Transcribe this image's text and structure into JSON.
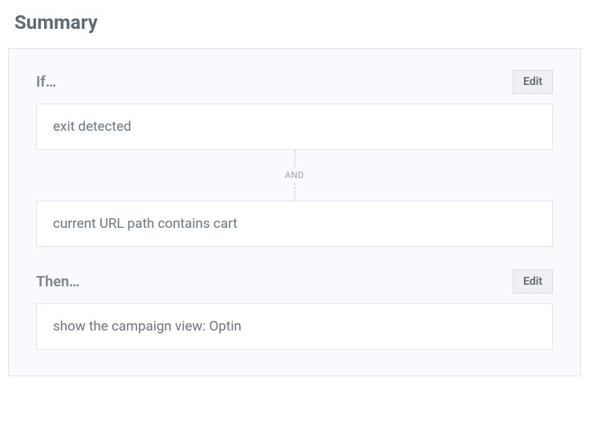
{
  "title": "Summary",
  "if": {
    "label": "If…",
    "edit": "Edit",
    "conditions": [
      "exit detected",
      "current URL path contains cart"
    ],
    "connector": "AND"
  },
  "then": {
    "label": "Then…",
    "edit": "Edit",
    "action": "show the campaign view: Optin"
  }
}
